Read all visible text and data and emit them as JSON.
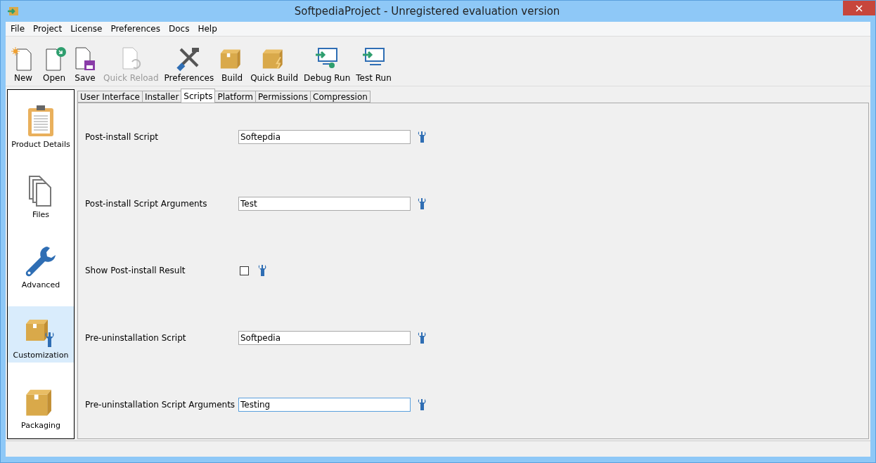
{
  "window": {
    "title": "SoftpediaProject - Unregistered evaluation version"
  },
  "menu": [
    "File",
    "Project",
    "License",
    "Preferences",
    "Docs",
    "Help"
  ],
  "toolbar": [
    {
      "label": "New",
      "kind": "new",
      "disabled": false
    },
    {
      "label": "Open",
      "kind": "open",
      "disabled": false
    },
    {
      "label": "Save",
      "kind": "save",
      "disabled": false
    },
    {
      "label": "Quick Reload",
      "kind": "reload",
      "disabled": true
    },
    {
      "label": "Preferences",
      "kind": "tools",
      "disabled": false
    },
    {
      "label": "Build",
      "kind": "box",
      "disabled": false
    },
    {
      "label": "Quick Build",
      "kind": "quickbox",
      "disabled": false
    },
    {
      "label": "Debug Run",
      "kind": "debug",
      "disabled": false
    },
    {
      "label": "Test Run",
      "kind": "run",
      "disabled": false
    }
  ],
  "sidebar": {
    "items": [
      {
        "label": "Product Details",
        "kind": "clipboard",
        "selected": false
      },
      {
        "label": "Files",
        "kind": "files",
        "selected": false
      },
      {
        "label": "Advanced",
        "kind": "wrench",
        "selected": false
      },
      {
        "label": "Customization",
        "kind": "boxwrench",
        "selected": true
      },
      {
        "label": "Packaging",
        "kind": "box",
        "selected": false
      }
    ]
  },
  "tabs": [
    {
      "label": "User Interface",
      "selected": false
    },
    {
      "label": "Installer",
      "selected": false
    },
    {
      "label": "Scripts",
      "selected": true
    },
    {
      "label": "Platform",
      "selected": false
    },
    {
      "label": "Permissions",
      "selected": false
    },
    {
      "label": "Compression",
      "selected": false
    }
  ],
  "fields": [
    {
      "label": "Post-install Script",
      "kind": "text",
      "value": "Softepdia",
      "focused": false
    },
    {
      "label": "Post-install Script Arguments",
      "kind": "text",
      "value": "Test",
      "focused": false
    },
    {
      "label": "Show Post-install Result",
      "kind": "checkbox",
      "checked": false
    },
    {
      "label": "Pre-uninstallation Script",
      "kind": "text",
      "value": "Softpedia",
      "focused": false
    },
    {
      "label": "Pre-uninstallation Script Arguments",
      "kind": "text",
      "value": "Testing",
      "focused": true
    }
  ]
}
